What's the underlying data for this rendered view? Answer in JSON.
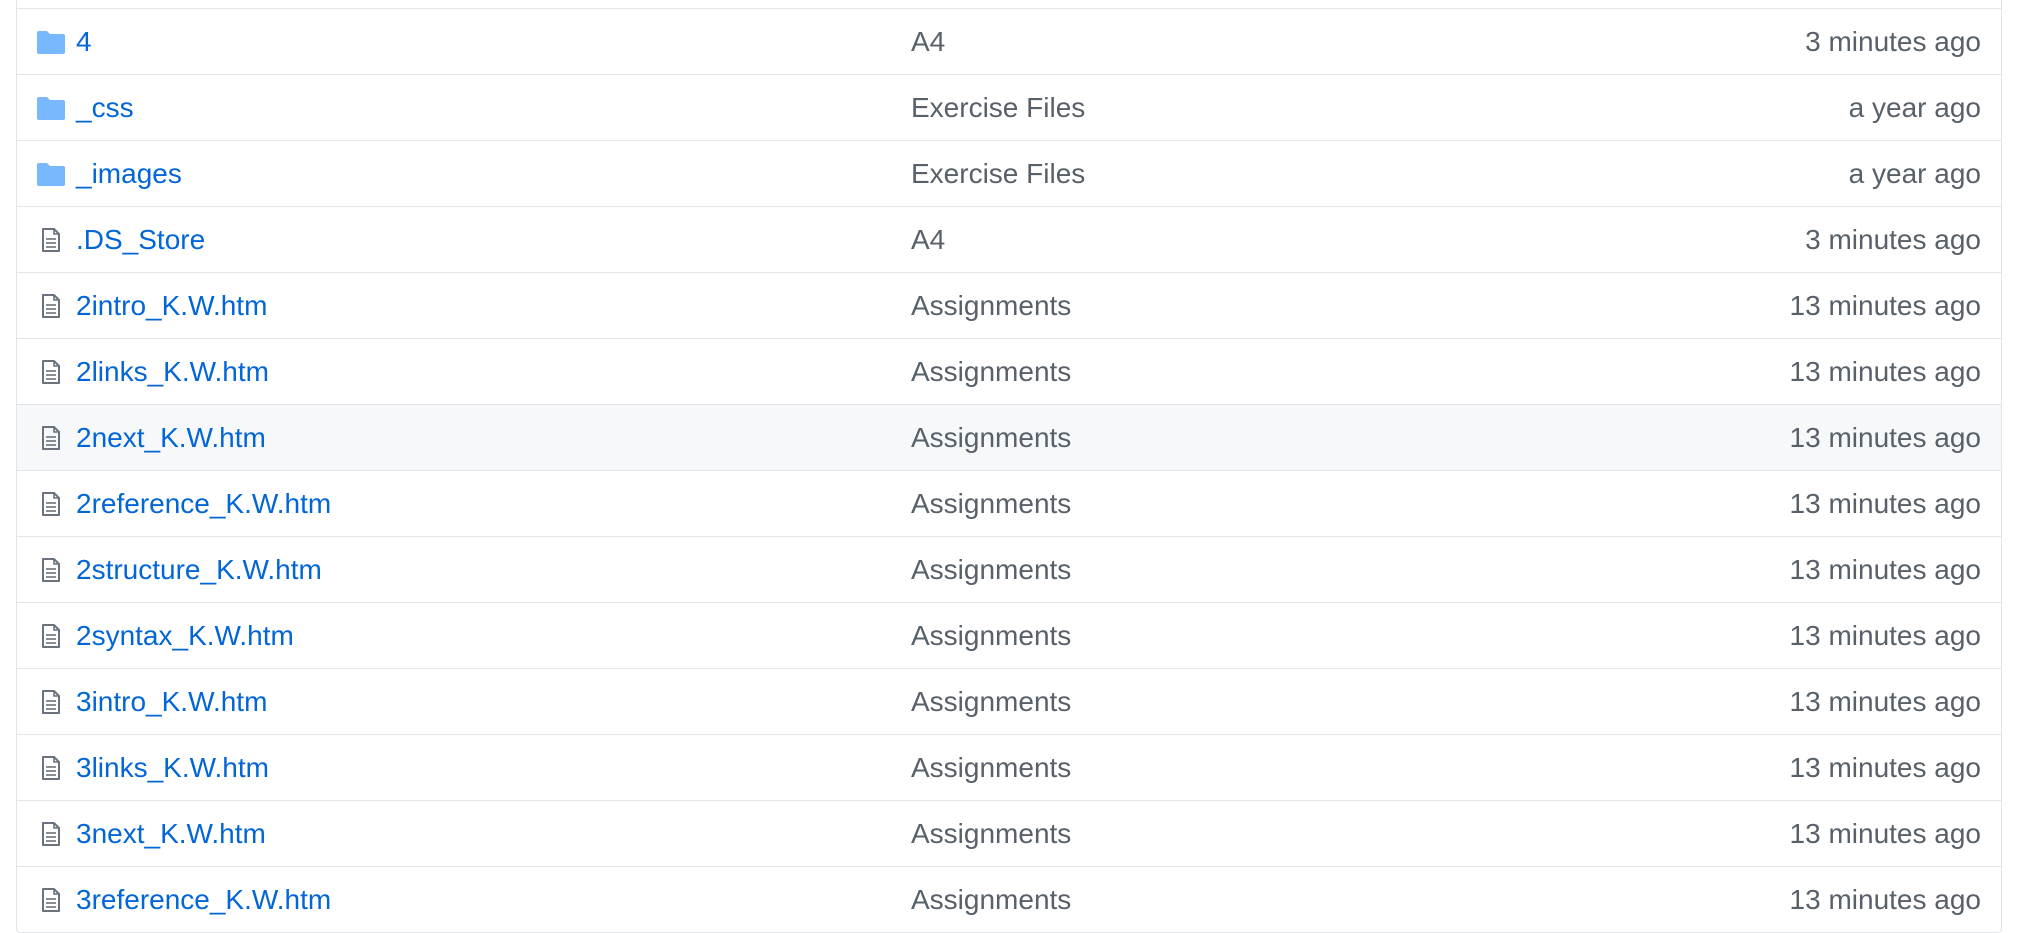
{
  "colors": {
    "link": "#0366d6",
    "muted": "#586069",
    "folder_icon": "#79b8ff",
    "file_icon": "#6a737d",
    "border": "#e1e4e8",
    "hover_row": "#f6f8fa"
  },
  "files": [
    {
      "type": "folder",
      "icon": "folder-icon",
      "name": "4",
      "message": "A4",
      "age": "3 minutes ago"
    },
    {
      "type": "folder",
      "icon": "folder-icon",
      "name": "_css",
      "message": "Exercise Files",
      "age": "a year ago"
    },
    {
      "type": "folder",
      "icon": "folder-icon",
      "name": "_images",
      "message": "Exercise Files",
      "age": "a year ago"
    },
    {
      "type": "file",
      "icon": "file-icon",
      "name": ".DS_Store",
      "message": "A4",
      "age": "3 minutes ago"
    },
    {
      "type": "file",
      "icon": "file-icon",
      "name": "2intro_K.W.htm",
      "message": "Assignments",
      "age": "13 minutes ago"
    },
    {
      "type": "file",
      "icon": "file-icon",
      "name": "2links_K.W.htm",
      "message": "Assignments",
      "age": "13 minutes ago"
    },
    {
      "type": "file",
      "icon": "file-icon",
      "name": "2next_K.W.htm",
      "message": "Assignments",
      "age": "13 minutes ago",
      "hovered": true
    },
    {
      "type": "file",
      "icon": "file-icon",
      "name": "2reference_K.W.htm",
      "message": "Assignments",
      "age": "13 minutes ago"
    },
    {
      "type": "file",
      "icon": "file-icon",
      "name": "2structure_K.W.htm",
      "message": "Assignments",
      "age": "13 minutes ago"
    },
    {
      "type": "file",
      "icon": "file-icon",
      "name": "2syntax_K.W.htm",
      "message": "Assignments",
      "age": "13 minutes ago"
    },
    {
      "type": "file",
      "icon": "file-icon",
      "name": "3intro_K.W.htm",
      "message": "Assignments",
      "age": "13 minutes ago"
    },
    {
      "type": "file",
      "icon": "file-icon",
      "name": "3links_K.W.htm",
      "message": "Assignments",
      "age": "13 minutes ago"
    },
    {
      "type": "file",
      "icon": "file-icon",
      "name": "3next_K.W.htm",
      "message": "Assignments",
      "age": "13 minutes ago"
    },
    {
      "type": "file",
      "icon": "file-icon",
      "name": "3reference_K.W.htm",
      "message": "Assignments",
      "age": "13 minutes ago"
    }
  ]
}
